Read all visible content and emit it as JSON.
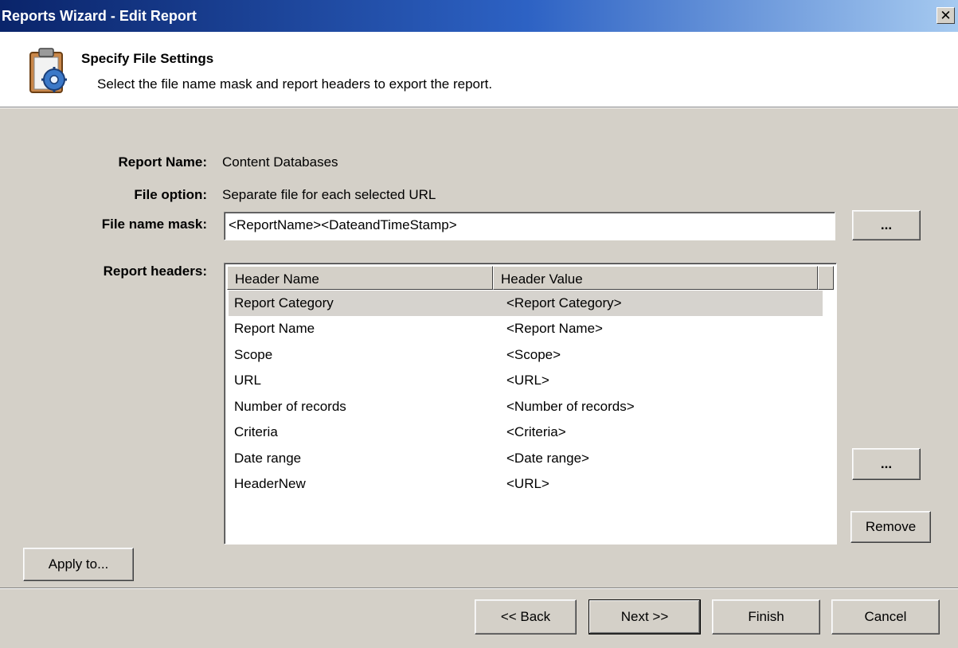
{
  "window": {
    "title": "Reports Wizard - Edit Report",
    "close_glyph": "✕"
  },
  "header": {
    "title": "Specify File Settings",
    "subtitle": "Select the file name mask and report headers to export the report.",
    "icon": "clipboard-gear-icon"
  },
  "form": {
    "report_name_label": "Report Name:",
    "report_name_value": "Content Databases",
    "file_option_label": "File option:",
    "file_option_value": "Separate file for each selected URL",
    "file_name_mask_label": "File name mask:",
    "file_name_mask_value": "<ReportName><DateandTimeStamp>",
    "browse_mask_label": "...",
    "report_headers_label": "Report headers:"
  },
  "headers_table": {
    "columns": [
      "Header Name",
      "Header Value"
    ],
    "rows": [
      {
        "name": "Report Category",
        "value": "<Report Category>",
        "selected": true
      },
      {
        "name": "Report Name",
        "value": "<Report Name>"
      },
      {
        "name": "Scope",
        "value": "<Scope>"
      },
      {
        "name": "URL",
        "value": "<URL>"
      },
      {
        "name": "Number of records",
        "value": "<Number of records>"
      },
      {
        "name": "Criteria",
        "value": "<Criteria>"
      },
      {
        "name": "Date range",
        "value": "<Date range>"
      },
      {
        "name": "HeaderNew",
        "value": "<URL>"
      }
    ]
  },
  "buttons": {
    "edit_header": "...",
    "remove": "Remove",
    "apply_to": "Apply to...",
    "back": "<< Back",
    "next": "Next >>",
    "finish": "Finish",
    "cancel": "Cancel"
  }
}
